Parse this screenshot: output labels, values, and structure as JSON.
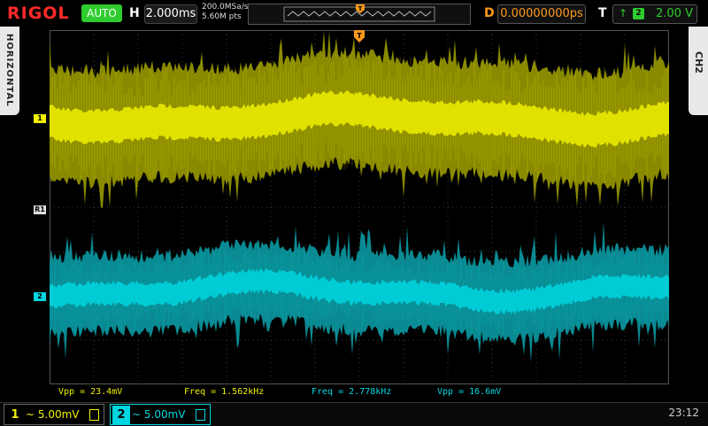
{
  "header": {
    "logo": "RIGOL",
    "run_mode": "AUTO",
    "h_label": "H",
    "timebase": "2.000ms",
    "sample_rate": "200.0MSa/s",
    "memory_depth": "5.60M pts",
    "d_label": "D",
    "delay": "0.00000000ps",
    "t_label": "T",
    "trigger_source": "2",
    "trigger_level": "2.00 V"
  },
  "side": {
    "left_tab": "HORIZONTAL",
    "right_tab": "CH2"
  },
  "markers": {
    "ch1": "1",
    "ref": "R1",
    "ch2": "2"
  },
  "measurements": [
    {
      "text": "Vpp = 23.4mV",
      "color": "#f0f000"
    },
    {
      "text": "Freq = 1.562kHz",
      "color": "#f0f000"
    },
    {
      "text": "Freq = 2.778kHz",
      "color": "#00d6e0"
    },
    {
      "text": "Vpp = 16.6mV",
      "color": "#00d6e0"
    }
  ],
  "bottom": {
    "ch1_num": "1",
    "ch1_scale": "~ 5.00mV",
    "ch2_num": "2",
    "ch2_scale": "~ 5.00mV",
    "clock": "23:12"
  },
  "colors": {
    "ch1": "#f0f000",
    "ch2": "#00d6e0",
    "grid": "#3a3a3a",
    "trigger": "#ff9a1a"
  }
}
